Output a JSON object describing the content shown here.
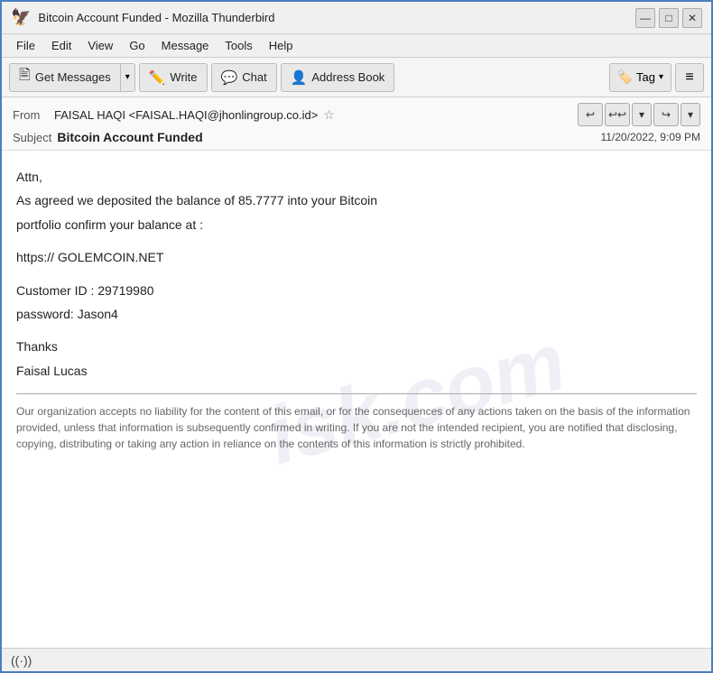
{
  "window": {
    "title": "Bitcoin Account Funded - Mozilla Thunderbird",
    "icon": "thunderbird-icon"
  },
  "titlebar": {
    "controls": {
      "minimize": "—",
      "maximize": "□",
      "close": "✕"
    }
  },
  "menubar": {
    "items": [
      "File",
      "Edit",
      "View",
      "Go",
      "Message",
      "Tools",
      "Help"
    ]
  },
  "toolbar": {
    "get_messages_label": "Get Messages",
    "write_label": "Write",
    "chat_label": "Chat",
    "address_book_label": "Address Book",
    "tag_label": "Tag",
    "menu_icon": "≡"
  },
  "email": {
    "from_label": "From",
    "from_value": "FAISAL HAQI <FAISAL.HAQI@jhonlingroup.co.id>",
    "subject_label": "Subject",
    "subject_value": "Bitcoin Account Funded",
    "date": "11/20/2022, 9:09 PM"
  },
  "body": {
    "greeting": "Attn,",
    "line1": "As agreed we deposited the balance of 85.7777 into your Bitcoin",
    "line2": "portfolio confirm your balance at :",
    "url": "https:// GOLEMCOIN.NET",
    "customer_id_label": "Customer ID : 29719980",
    "password_label": "password:   Jason4",
    "thanks": "Thanks",
    "signature": "Faisal Lucas"
  },
  "disclaimer": {
    "text": "Our organization accepts no liability for the content of this email, or for the consequences of any actions taken on the basis of the information provided, unless that information is subsequently confirmed in writing. If you are not the intended recipient, you are notified that disclosing, copying, distributing or taking any action in reliance on the contents of this information is strictly prohibited."
  },
  "watermark": {
    "text1": "isk.com",
    "text2": "isk.com"
  },
  "statusbar": {
    "wifi_icon": "((·))"
  }
}
